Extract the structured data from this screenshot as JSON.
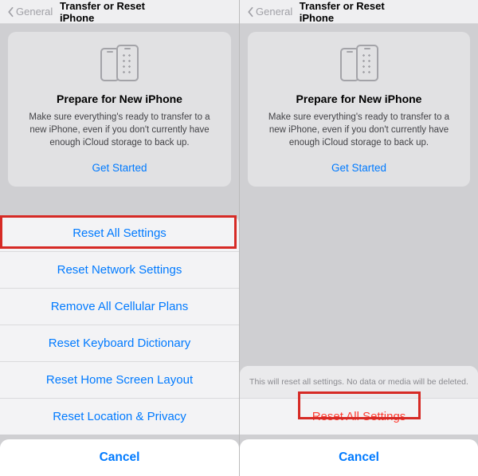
{
  "nav": {
    "back_label": "General",
    "title": "Transfer or Reset iPhone"
  },
  "card": {
    "title": "Prepare for New iPhone",
    "description": "Make sure everything's ready to transfer to a new iPhone, even if you don't currently have enough iCloud storage to back up.",
    "get_started": "Get Started"
  },
  "left_sheet": {
    "items": [
      "Reset All Settings",
      "Reset Network Settings",
      "Remove All Cellular Plans",
      "Reset Keyboard Dictionary",
      "Reset Home Screen Layout",
      "Reset Location & Privacy"
    ],
    "cancel": "Cancel"
  },
  "right_sheet": {
    "message": "This will reset all settings. No data or media will be deleted.",
    "confirm": "Reset All Settings",
    "cancel": "Cancel"
  },
  "icon_names": {
    "back_chevron": "chevron-left-icon",
    "phone_small": "iphone-icon",
    "phone_big": "iphone-apps-icon"
  }
}
